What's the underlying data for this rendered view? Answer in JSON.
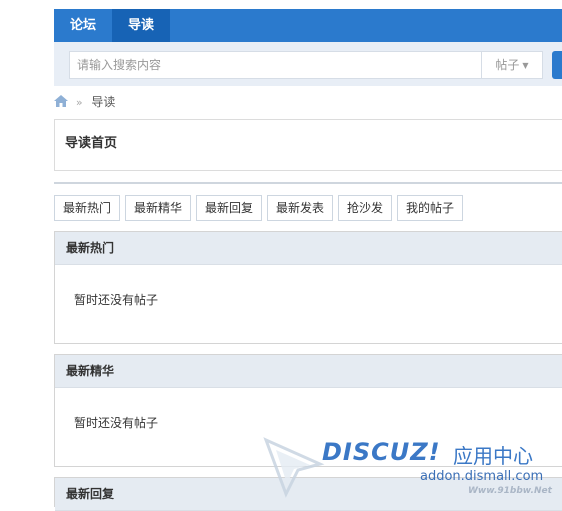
{
  "nav": {
    "items": [
      "论坛",
      "导读"
    ]
  },
  "search": {
    "placeholder": "请输入搜索内容",
    "type_label": "帖子"
  },
  "breadcrumb": {
    "current": "导读"
  },
  "page": {
    "title": "导读首页"
  },
  "tabs": [
    "最新热门",
    "最新精华",
    "最新回复",
    "最新发表",
    "抢沙发",
    "我的帖子"
  ],
  "sections": [
    {
      "title": "最新热门",
      "empty_text": "暂时还没有帖子"
    },
    {
      "title": "最新精华",
      "empty_text": "暂时还没有帖子"
    },
    {
      "title": "最新回复",
      "empty_text": ""
    }
  ],
  "watermark": {
    "brand": "DISCUZ!",
    "suffix": "应用中心",
    "domain": "addon.dismall.com",
    "sub": "Www.91bbw.Net"
  },
  "colors": {
    "nav_bg": "#2b7acd",
    "nav_active": "#1763b5",
    "section_header_bg": "#e5ebf2"
  }
}
